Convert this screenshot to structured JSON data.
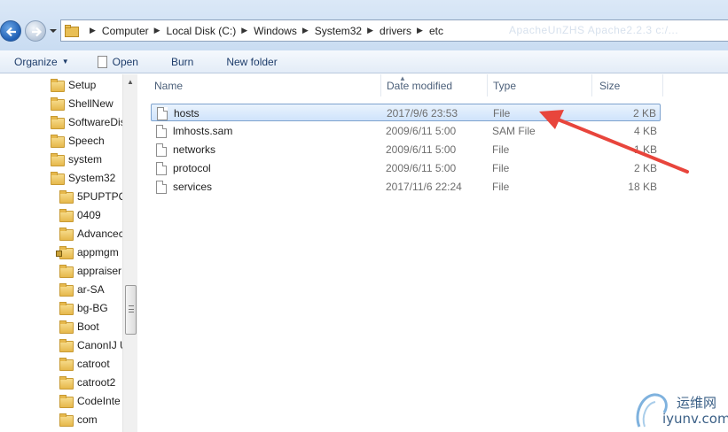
{
  "address_bar": {
    "crumbs": [
      "Computer",
      "Local Disk (C:)",
      "Windows",
      "System32",
      "drivers",
      "etc"
    ],
    "ghost_text": "ApacheUnZHS Apache2.2.3 c:/..."
  },
  "toolbar": {
    "organize_label": "Organize",
    "open_label": "Open",
    "burn_label": "Burn",
    "new_folder_label": "New folder"
  },
  "nav_tree": {
    "items": [
      {
        "label": "Setup"
      },
      {
        "label": "ShellNew"
      },
      {
        "label": "SoftwareDis"
      },
      {
        "label": "Speech"
      },
      {
        "label": "system"
      },
      {
        "label": "System32"
      },
      {
        "label": "5PUPTPQ"
      },
      {
        "label": "0409"
      },
      {
        "label": "Advancec"
      },
      {
        "label": "appmgm"
      },
      {
        "label": "appraiser"
      },
      {
        "label": "ar-SA"
      },
      {
        "label": "bg-BG"
      },
      {
        "label": "Boot"
      },
      {
        "label": "CanonIJ U"
      },
      {
        "label": "catroot"
      },
      {
        "label": "catroot2"
      },
      {
        "label": "CodeInte"
      },
      {
        "label": "com"
      }
    ]
  },
  "columns": {
    "name": "Name",
    "date": "Date modified",
    "type": "Type",
    "size": "Size"
  },
  "files": [
    {
      "name": "hosts",
      "date": "2017/9/6 23:53",
      "type": "File",
      "size": "2 KB",
      "selected": true
    },
    {
      "name": "lmhosts.sam",
      "date": "2009/6/11 5:00",
      "type": "SAM File",
      "size": "4 KB",
      "selected": false
    },
    {
      "name": "networks",
      "date": "2009/6/11 5:00",
      "type": "File",
      "size": "1 KB",
      "selected": false
    },
    {
      "name": "protocol",
      "date": "2009/6/11 5:00",
      "type": "File",
      "size": "2 KB",
      "selected": false
    },
    {
      "name": "services",
      "date": "2017/11/6 22:24",
      "type": "File",
      "size": "18 KB",
      "selected": false
    }
  ],
  "watermark": {
    "cn": "运维网",
    "en": "iyunv.com"
  },
  "colors": {
    "accent": "#1f5fb4",
    "selection": "#cfe3fb",
    "annotation": "#e8453c"
  }
}
